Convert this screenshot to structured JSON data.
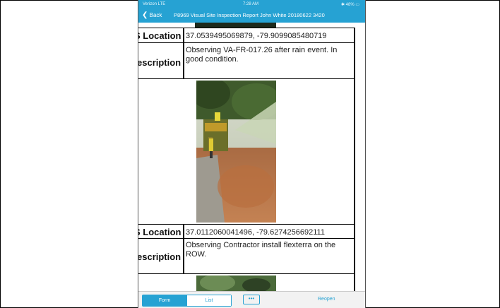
{
  "status_bar": {
    "carrier": "Verizon LTE",
    "time": "7:28 AM",
    "battery": "48%"
  },
  "nav": {
    "back_label": "Back",
    "title": "P8969 Visual Site Inspection Report John White 20180622 3420"
  },
  "entries": [
    {
      "location_label": "S Location",
      "location_value": "37.0539495069879, -79.9099085480719",
      "description_label": "escription",
      "description_value": "Observing VA-FR-017.26 after rain event. In good condition."
    },
    {
      "location_label": "S Location",
      "location_value": "37.0112060041496, -79.6274256692111",
      "description_label": "escription",
      "description_value": "Observing Contractor install flexterra on the ROW."
    }
  ],
  "toolbar": {
    "form_label": "Form",
    "list_label": "List",
    "more_label": "•••",
    "reopen_label": "Reopen"
  },
  "colors": {
    "accent": "#26a2d3"
  }
}
